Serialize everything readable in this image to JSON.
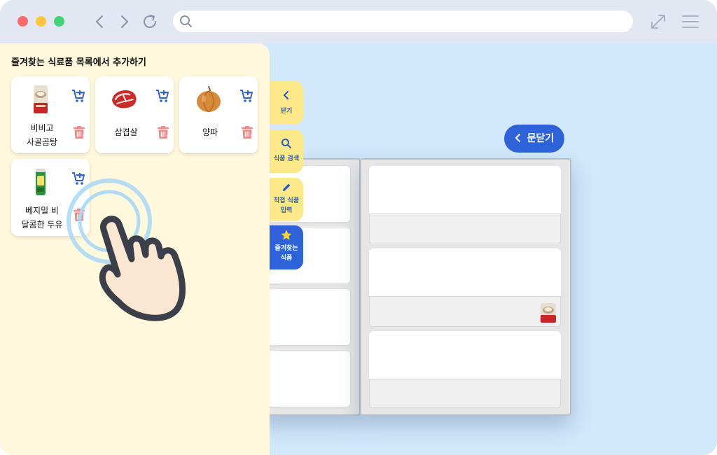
{
  "browser": {
    "traffic_lights": [
      "#ff6b6b",
      "#ffc53d",
      "#43d37a"
    ],
    "address": ""
  },
  "panel": {
    "title": "즐겨찾는 식료품 목록에서 추가하기",
    "items": [
      {
        "label": "비비고 사골곰탕",
        "icon": "bone-broth-pouch-icon"
      },
      {
        "label": "삼겹살",
        "icon": "pork-belly-icon"
      },
      {
        "label": "양파",
        "icon": "onion-icon"
      },
      {
        "label": "베지밀 비 달콤한 두유",
        "icon": "soy-milk-can-icon"
      }
    ]
  },
  "side_tabs": [
    {
      "label": "닫기",
      "icon": "chevron-left-icon"
    },
    {
      "label": "식품 검색",
      "icon": "search-icon"
    },
    {
      "label": "직접 식품 입력",
      "icon": "pencil-icon"
    },
    {
      "label": "즐겨찾는 식품",
      "icon": "star-icon",
      "active": true
    }
  ],
  "fridge": {
    "close_door_label": "문닫기"
  },
  "colors": {
    "accent": "#2d63d7",
    "panel_bg": "#fff8dc",
    "tab_bg": "#fde98a",
    "page_bg": "#d2e8fb",
    "delete": "#f08a8a"
  }
}
